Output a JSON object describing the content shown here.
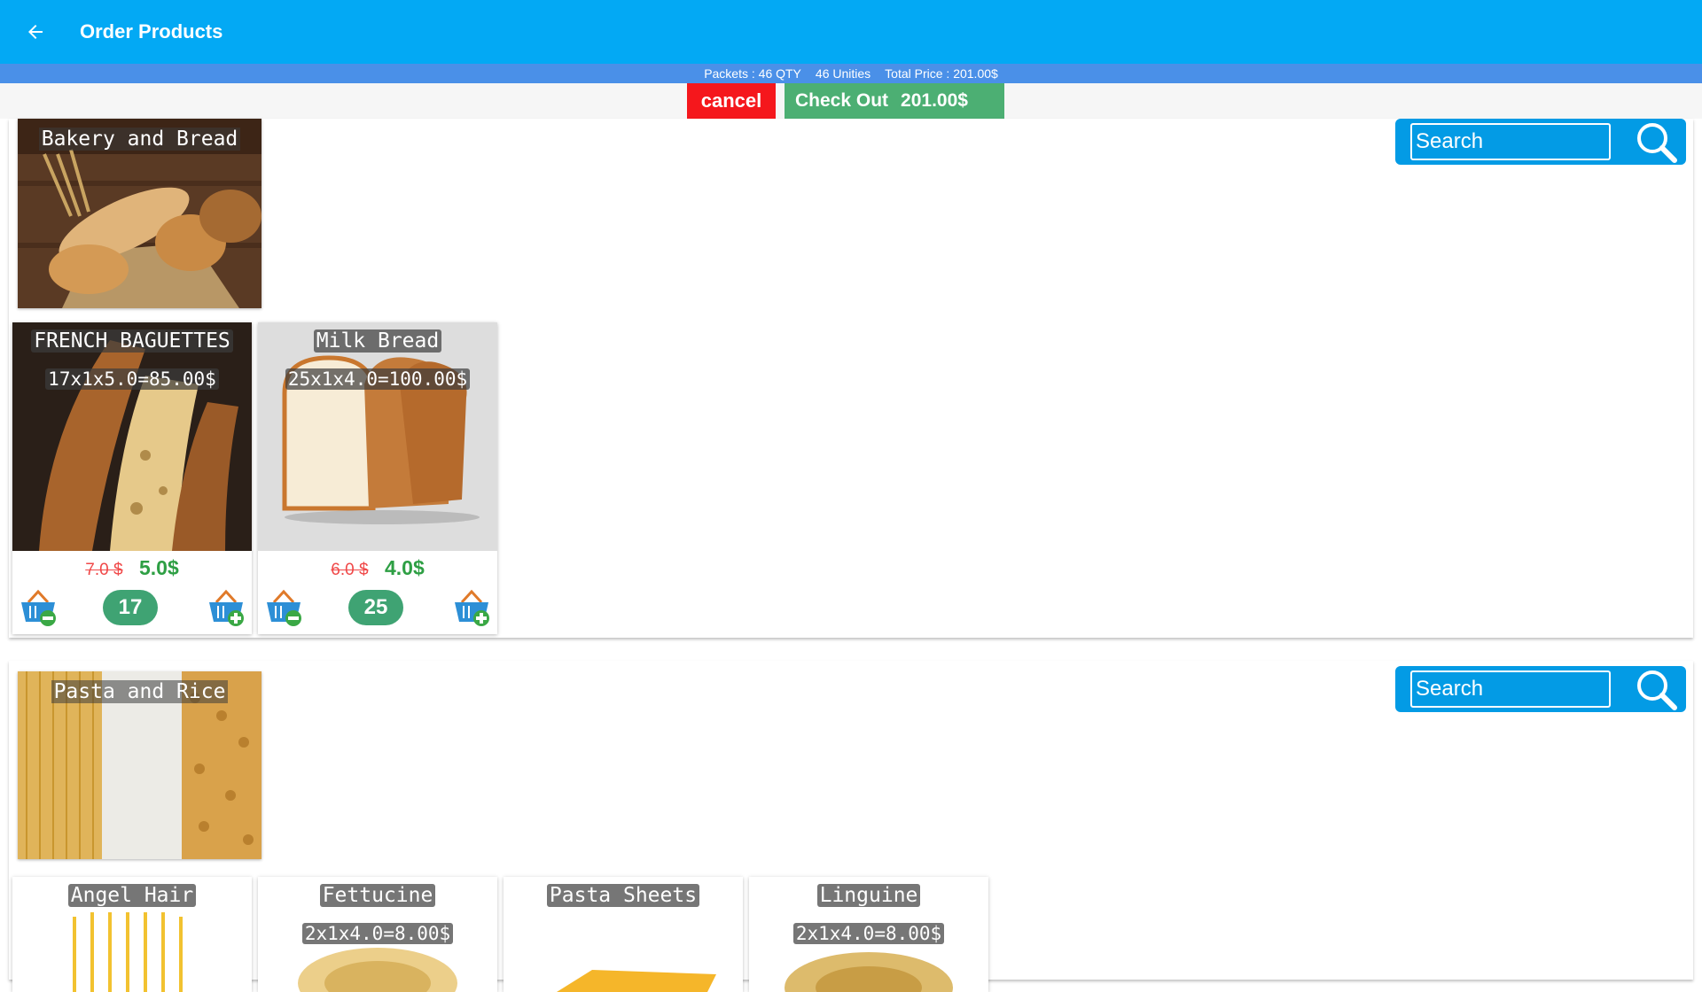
{
  "appbar": {
    "title": "Order Products"
  },
  "summary": {
    "packets": "Packets : 46 QTY",
    "unities": "46 Unities",
    "total": "Total Price : 201.00$"
  },
  "actions": {
    "cancel": "cancel",
    "checkout_label": "Check Out",
    "checkout_total": "201.00$"
  },
  "sections": [
    {
      "category": "Bakery and Bread",
      "search_placeholder": "Search",
      "products": [
        {
          "name": "FRENCH BAGUETTES",
          "calc": "17x1x5.0=85.00$",
          "old_price": "7.0 $",
          "new_price": "5.0$",
          "qty": "17"
        },
        {
          "name": "Milk Bread",
          "calc": "25x1x4.0=100.00$",
          "old_price": "6.0 $",
          "new_price": "4.0$",
          "qty": "25"
        }
      ]
    },
    {
      "category": "Pasta and Rice",
      "search_placeholder": "Search",
      "products": [
        {
          "name": "Angel Hair",
          "calc": ""
        },
        {
          "name": "Fettucine",
          "calc": "2x1x4.0=8.00$"
        },
        {
          "name": "Pasta Sheets",
          "calc": ""
        },
        {
          "name": "Linguine",
          "calc": "2x1x4.0=8.00$"
        }
      ]
    }
  ],
  "colors": {
    "appbar": "#03a9f4",
    "summary_bar": "#4a90e8",
    "cancel": "#f5171c",
    "checkout": "#4caf73",
    "qty_badge": "#3fa373",
    "search_box": "#039be5"
  }
}
